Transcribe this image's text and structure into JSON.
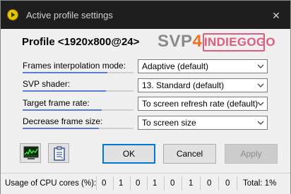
{
  "window": {
    "title": "Active profile settings",
    "close_symbol": "✕",
    "colors": {
      "titlebar": "#1e1e1e",
      "accent": "#0078d7",
      "icon_yellow": "#e8c400"
    }
  },
  "header": {
    "profile_title": "Profile <1920x800@24>",
    "logo_svp": "SVP",
    "logo_version": "4",
    "logo_partner": "INDIEGOGO"
  },
  "settings": [
    {
      "label": "Frames interpolation mode:",
      "value": "Adaptive (default)"
    },
    {
      "label": "SVP shader:",
      "value": "13. Standard (default)"
    },
    {
      "label": "Target frame rate:",
      "value": "To screen refresh rate (default)"
    },
    {
      "label": "Decrease frame size:",
      "value": "To screen size"
    }
  ],
  "buttons": {
    "ok": "OK",
    "cancel": "Cancel",
    "apply": "Apply"
  },
  "icons": {
    "graph_button": "graph-monitor-icon",
    "clipboard_button": "clipboard-icon"
  },
  "status": {
    "label": "Usage of CPU cores (%):",
    "cores": [
      "0",
      "1",
      "0",
      "1",
      "0",
      "1",
      "0",
      "0"
    ],
    "total": "Total: 1%"
  }
}
